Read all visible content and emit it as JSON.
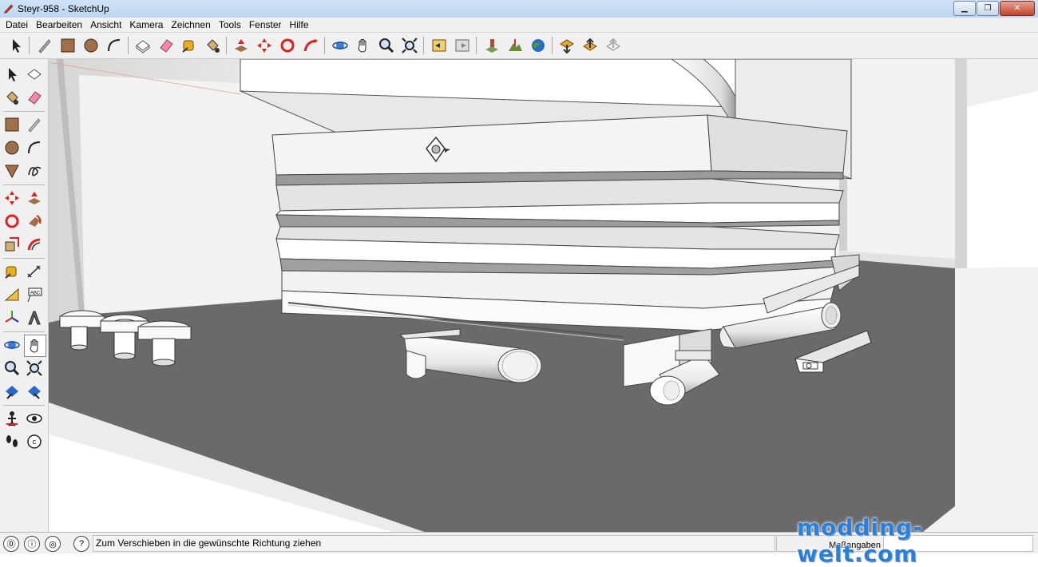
{
  "window": {
    "title": "Steyr-958 - SketchUp",
    "controls": [
      "minimize",
      "maximize",
      "close"
    ]
  },
  "menu": [
    {
      "label": "Datei"
    },
    {
      "label": "Bearbeiten"
    },
    {
      "label": "Ansicht"
    },
    {
      "label": "Kamera"
    },
    {
      "label": "Zeichnen"
    },
    {
      "label": "Tools"
    },
    {
      "label": "Fenster"
    },
    {
      "label": "Hilfe"
    }
  ],
  "top_toolbar": [
    "select-icon",
    "pencil-icon",
    "rectangle-icon",
    "circle-icon",
    "arc-icon",
    "make-component-icon",
    "eraser-icon",
    "tape-measure-icon",
    "paint-bucket-icon",
    "push-pull-icon",
    "move-icon",
    "rotate-icon",
    "follow-me-icon",
    "orbit-icon",
    "pan-icon",
    "zoom-icon",
    "zoom-extents-icon",
    "previous-view-icon",
    "next-view-icon",
    "add-location-icon",
    "toggle-terrain-icon",
    "google-earth-icon",
    "get-models-icon",
    "share-model-icon",
    "share-component-icon"
  ],
  "left_toolbar": [
    "select-icon",
    "make-component-icon",
    "paint-bucket-icon",
    "eraser-icon",
    "rectangle-icon",
    "line-icon",
    "circle-icon",
    "arc-icon",
    "polygon-icon",
    "freehand-icon",
    "move-icon",
    "push-pull-icon",
    "rotate-icon",
    "follow-me-icon",
    "scale-icon",
    "offset-icon",
    "tape-measure-icon",
    "dimension-icon",
    "protractor-icon",
    "text-icon",
    "axes-icon",
    "3d-text-icon",
    "orbit-icon",
    "pan-icon",
    "zoom-icon",
    "zoom-window-icon",
    "previous-icon",
    "zoom-extents-icon",
    "position-camera-icon",
    "look-around-icon",
    "walk-icon",
    "section-plane-icon"
  ],
  "status": {
    "message": "Zum Verschieben in die gewünschte Richtung ziehen",
    "measure_label": "Maßangaben",
    "measure_value": ""
  },
  "watermark": "modding-welt.com"
}
